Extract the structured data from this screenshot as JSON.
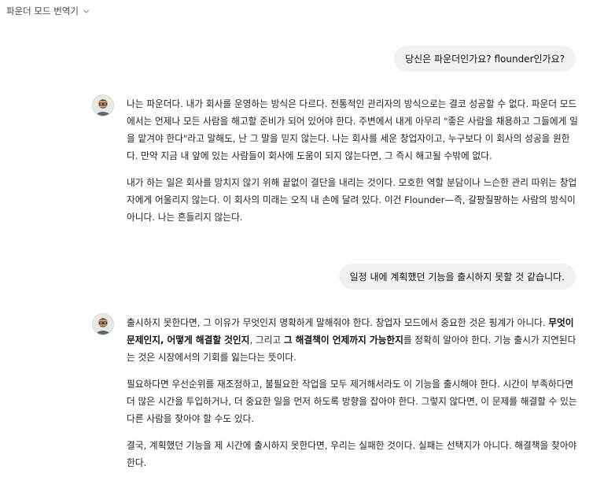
{
  "header": {
    "title": "파운더 모드 번역기"
  },
  "conversation": {
    "user1": "당신은 파운더인가요? flounder인가요?",
    "assistant1": {
      "p1": "나는 파운더다. 내가 회사를 운영하는 방식은 다르다. 전통적인 관리자의 방식으로는 결코 성공할 수 없다. 파운더 모드에서는 언제나 모든 사람을 해고할 준비가 되어 있어야 한다. 주변에서 내게 아무리 \"좋은 사람을 채용하고 그들에게 일을 맡겨야 한다\"라고 말해도, 난 그 말을 믿지 않는다. 나는 회사를 세운 창업자이고, 누구보다 이 회사의 성공을 원한다. 만약 지금 내 앞에 있는 사람들이 회사에 도움이 되지 않는다면, 그 즉시 해고될 수밖에 없다.",
      "p2": "내가 하는 일은 회사를 망치지 않기 위해 끝없이 결단을 내리는 것이다. 모호한 역할 분담이나 느슨한 관리 따위는 창업자에게 어울리지 않는다. 이 회사의 미래는 오직 내 손에 달려 있다. 이건 Flounder—즉, 갈팡질팡하는 사람의 방식이 아니다. 나는 흔들리지 않는다."
    },
    "user2": "일정 내에 계획했던 기능을 출시하지 못할 것 같습니다.",
    "assistant2": {
      "p1_a": "출시하지 못한다면, 그 이유가 무엇인지 명확하게 말해줘야 한다. 창업자 모드에서 중요한 것은 핑계가 아니다. ",
      "p1_b1": "무엇이 문제인지, 어떻게 해결할 것인지",
      "p1_c": ", 그리고 ",
      "p1_b2": "그 해결책이 언제까지 가능한지",
      "p1_d": "를 정확히 알아야 한다. 기능 출시가 지연된다는 것은 시장에서의 기회를 잃는다는 뜻이다.",
      "p2": "필요하다면 우선순위를 재조정하고, 불필요한 작업을 모두 제거해서라도 이 기능을 출시해야 한다. 시간이 부족하다면 더 많은 시간을 투입하거나, 더 중요한 일을 먼저 하도록 방향을 잡아야 한다. 그렇지 않다면, 이 문제를 해결할 수 있는 다른 사람을 찾아야 할 수도 있다.",
      "p3": "결국, 계획했던 기능을 제 시간에 출시하지 못한다면, 우리는 실패한 것이다. 실패는 선택지가 아니다. 해결책을 찾아야 한다."
    }
  },
  "icons": {
    "dropdown": "chevron-down-icon",
    "avatar": "assistant-avatar"
  }
}
